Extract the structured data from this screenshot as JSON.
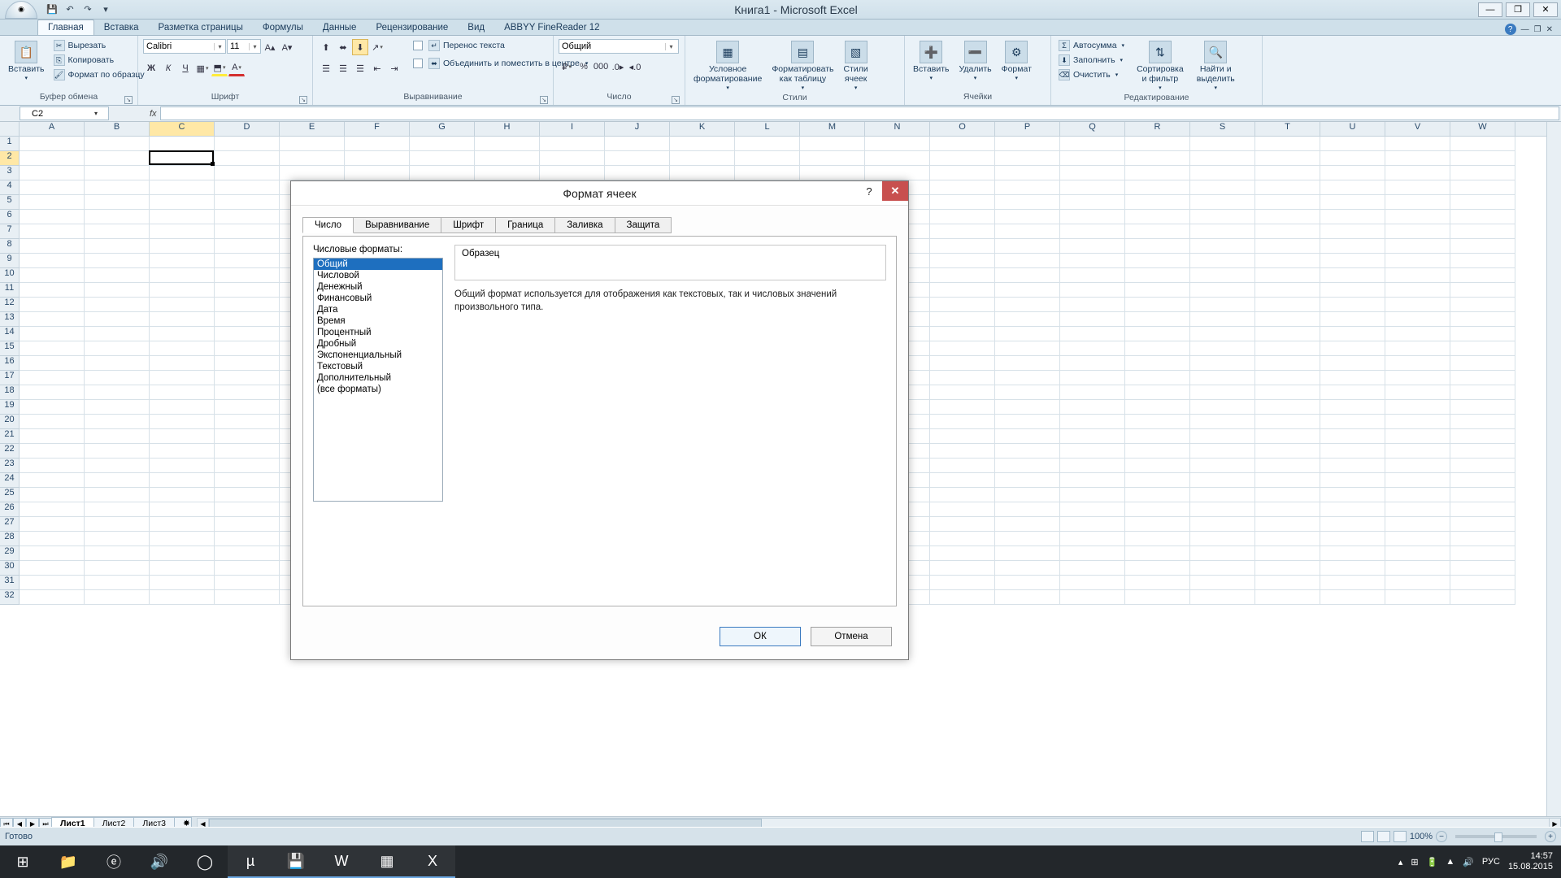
{
  "titlebar": {
    "title": "Книга1 - Microsoft Excel"
  },
  "window_controls": {
    "minimize": "—",
    "maximize": "❐",
    "close": "✕"
  },
  "qat": {
    "save": "💾",
    "undo": "↶",
    "redo": "↷",
    "customize": "▾"
  },
  "ribbon_tabs": [
    "Главная",
    "Вставка",
    "Разметка страницы",
    "Формулы",
    "Данные",
    "Рецензирование",
    "Вид",
    "ABBYY FineReader 12"
  ],
  "ribbon": {
    "clipboard": {
      "label": "Буфер обмена",
      "paste": "Вставить",
      "cut": "Вырезать",
      "copy": "Копировать",
      "format_painter": "Формат по образцу"
    },
    "font": {
      "label": "Шрифт",
      "name": "Calibri",
      "size": "11",
      "bold": "Ж",
      "italic": "К",
      "underline": "Ч"
    },
    "alignment": {
      "label": "Выравнивание",
      "wrap": "Перенос текста",
      "merge": "Объединить и поместить в центре"
    },
    "number": {
      "label": "Число",
      "format": "Общий"
    },
    "styles": {
      "label": "Стили",
      "cond": "Условное\nформатирование",
      "table": "Форматировать\nкак таблицу",
      "cell": "Стили\nячеек"
    },
    "cells": {
      "label": "Ячейки",
      "insert": "Вставить",
      "delete": "Удалить",
      "format": "Формат"
    },
    "editing": {
      "label": "Редактирование",
      "autosum": "Автосумма",
      "fill": "Заполнить",
      "clear": "Очистить",
      "sort": "Сортировка\nи фильтр",
      "find": "Найти и\nвыделить"
    }
  },
  "name_box": "C2",
  "columns": [
    "A",
    "B",
    "C",
    "D",
    "E",
    "F",
    "G",
    "H",
    "I",
    "J",
    "K",
    "L",
    "M",
    "N",
    "O",
    "P",
    "Q",
    "R",
    "S",
    "T",
    "U",
    "V",
    "W"
  ],
  "row_count": 32,
  "selected_cell": {
    "col": 2,
    "row": 1
  },
  "sheets": [
    "Лист1",
    "Лист2",
    "Лист3"
  ],
  "status": "Готово",
  "zoom": "100%",
  "dialog": {
    "title": "Формат ячеек",
    "tabs": [
      "Число",
      "Выравнивание",
      "Шрифт",
      "Граница",
      "Заливка",
      "Защита"
    ],
    "formats_label": "Числовые форматы:",
    "formats": [
      "Общий",
      "Числовой",
      "Денежный",
      "Финансовый",
      "Дата",
      "Время",
      "Процентный",
      "Дробный",
      "Экспоненциальный",
      "Текстовый",
      "Дополнительный",
      "(все форматы)"
    ],
    "sample_label": "Образец",
    "description": "Общий формат используется для отображения как текстовых, так и числовых значений произвольного типа.",
    "ok": "ОК",
    "cancel": "Отмена"
  },
  "taskbar": {
    "lang": "РУС",
    "time": "14:57",
    "date": "15.08.2015"
  }
}
